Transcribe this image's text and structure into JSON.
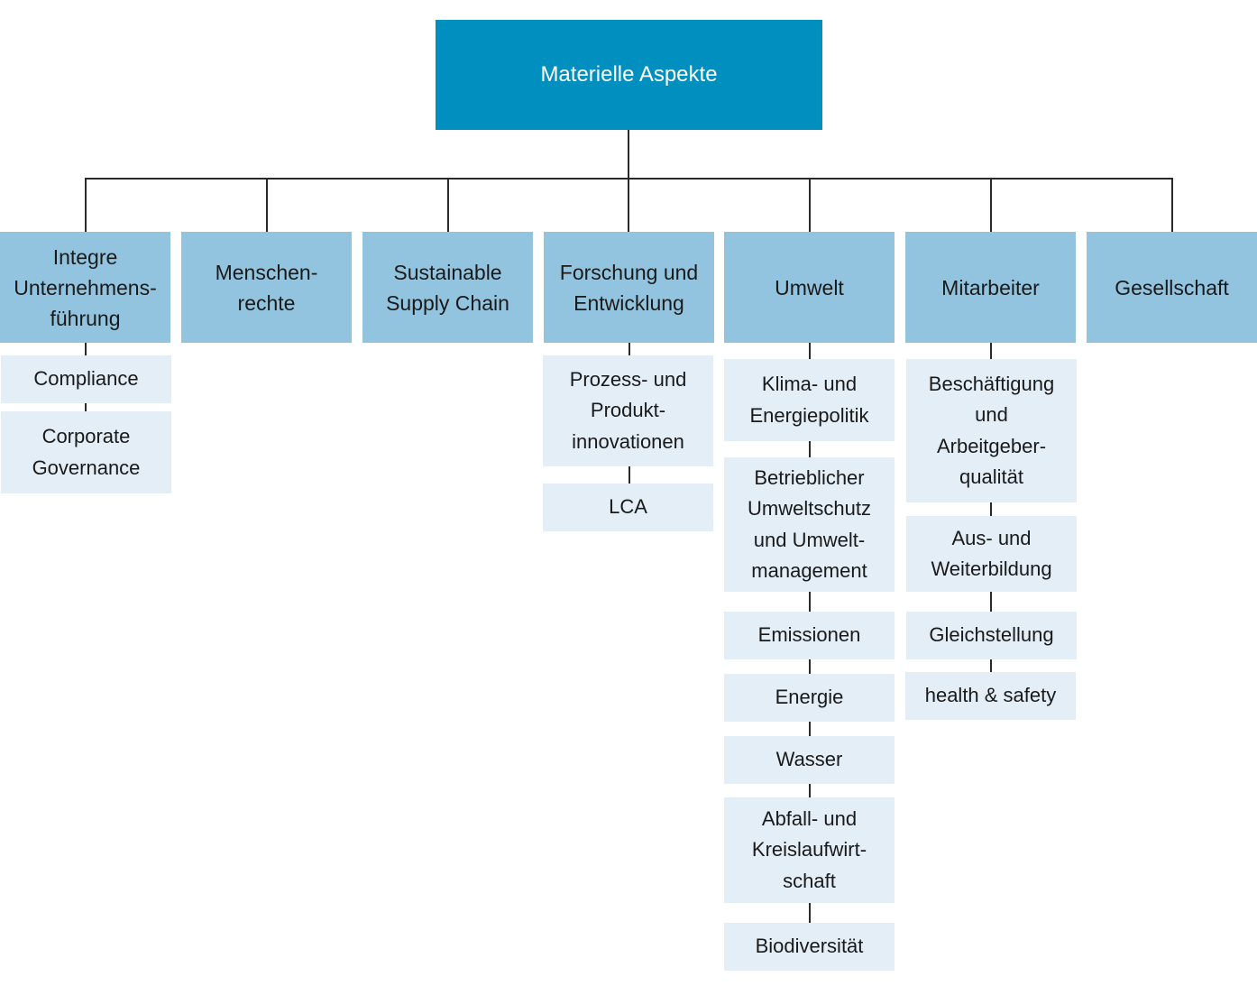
{
  "root": {
    "label": "Materielle Aspekte"
  },
  "categories": [
    {
      "label": "Integre\nUnternehmens-\nführung",
      "children": [
        "Compliance",
        "Corporate\nGovernance"
      ]
    },
    {
      "label": "Menschen-\nrechte",
      "children": []
    },
    {
      "label": "Sustainable\nSupply Chain",
      "children": []
    },
    {
      "label": "Forschung und\nEntwicklung",
      "children": [
        "Prozess- und\nProdukt-\ninnovationen",
        "LCA"
      ]
    },
    {
      "label": "Umwelt",
      "children": [
        "Klima- und\nEnergiepolitik",
        "Betrieblicher\nUmweltschutz\nund Umwelt-\nmanagement",
        "Emissionen",
        "Energie",
        "Wasser",
        "Abfall- und\nKreislaufwirt-\nschaft",
        "Biodiversität"
      ]
    },
    {
      "label": "Mitarbeiter",
      "children": [
        "Beschäftigung\nund\nArbeitgeber-\nqualität",
        "Aus- und\nWeiterbildung",
        "Gleichstellung",
        "health & safety"
      ]
    },
    {
      "label": "Gesellschaft",
      "children": []
    }
  ],
  "colors": {
    "root": "#008fbe",
    "category": "#92c4df",
    "subitem": "#e3eef7",
    "connector": "#2a2a2a"
  }
}
